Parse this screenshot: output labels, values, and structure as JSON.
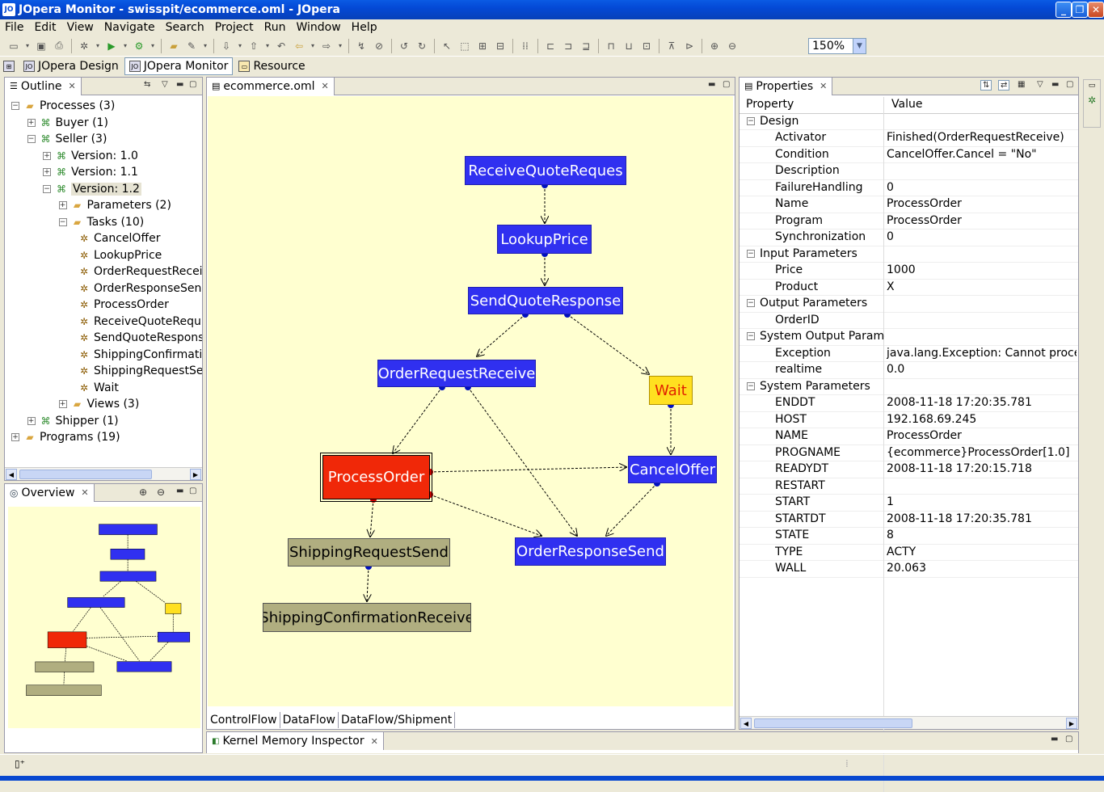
{
  "window": {
    "title": "JOpera Monitor - swisspit/ecommerce.oml - JOpera",
    "icon_text": "JO"
  },
  "menu": [
    "File",
    "Edit",
    "View",
    "Navigate",
    "Search",
    "Project",
    "Run",
    "Window",
    "Help"
  ],
  "toolbar": {
    "zoom": "150%"
  },
  "perspectives": [
    "JOpera Design",
    "JOpera Monitor",
    "Resource"
  ],
  "outline": {
    "tab": "Outline",
    "rows": [
      {
        "label": "Processes (3)",
        "depth": 0,
        "toggle": "−",
        "icon": "folder"
      },
      {
        "label": "Buyer (1)",
        "depth": 1,
        "toggle": "+",
        "icon": "proc"
      },
      {
        "label": "Seller (3)",
        "depth": 1,
        "toggle": "−",
        "icon": "proc"
      },
      {
        "label": "Version: 1.0",
        "depth": 2,
        "toggle": "+",
        "icon": "proc"
      },
      {
        "label": "Version: 1.1",
        "depth": 2,
        "toggle": "+",
        "icon": "proc"
      },
      {
        "label": "Version: 1.2",
        "depth": 2,
        "toggle": "−",
        "icon": "proc",
        "selected": true
      },
      {
        "label": "Parameters (2)",
        "depth": 3,
        "toggle": "+",
        "icon": "folder"
      },
      {
        "label": "Tasks (10)",
        "depth": 3,
        "toggle": "−",
        "icon": "folder"
      },
      {
        "label": "CancelOffer",
        "depth": 4,
        "icon": "task"
      },
      {
        "label": "LookupPrice",
        "depth": 4,
        "icon": "task"
      },
      {
        "label": "OrderRequestRecei",
        "depth": 4,
        "icon": "task"
      },
      {
        "label": "OrderResponseSen",
        "depth": 4,
        "icon": "task"
      },
      {
        "label": "ProcessOrder",
        "depth": 4,
        "icon": "task"
      },
      {
        "label": "ReceiveQuoteRequ",
        "depth": 4,
        "icon": "task"
      },
      {
        "label": "SendQuoteRespons",
        "depth": 4,
        "icon": "task"
      },
      {
        "label": "ShippingConfirmatio",
        "depth": 4,
        "icon": "task"
      },
      {
        "label": "ShippingRequestSer",
        "depth": 4,
        "icon": "task"
      },
      {
        "label": "Wait",
        "depth": 4,
        "icon": "task"
      },
      {
        "label": "Views (3)",
        "depth": 3,
        "toggle": "+",
        "icon": "folder"
      },
      {
        "label": "Shipper (1)",
        "depth": 1,
        "toggle": "+",
        "icon": "proc"
      },
      {
        "label": "Programs (19)",
        "depth": 0,
        "toggle": "+",
        "icon": "folder"
      }
    ]
  },
  "overview": {
    "tab": "Overview"
  },
  "editor": {
    "tab": "ecommerce.oml",
    "bottom_tabs": [
      "ControlFlow",
      "DataFlow",
      "DataFlow/Shipment"
    ],
    "nodes": [
      {
        "id": "rqr",
        "label": "ReceiveQuoteReques",
        "style": "blue"
      },
      {
        "id": "lp",
        "label": "LookupPrice",
        "style": "blue"
      },
      {
        "id": "sqr",
        "label": "SendQuoteResponse",
        "style": "blue"
      },
      {
        "id": "orr",
        "label": "OrderRequestReceive",
        "style": "blue"
      },
      {
        "id": "wait",
        "label": "Wait",
        "style": "yellow"
      },
      {
        "id": "po",
        "label": "ProcessOrder",
        "style": "red"
      },
      {
        "id": "co",
        "label": "CancelOffer",
        "style": "blue"
      },
      {
        "id": "ors",
        "label": "OrderResponseSend",
        "style": "blue"
      },
      {
        "id": "srs",
        "label": "ShippingRequestSend",
        "style": "gray"
      },
      {
        "id": "scr",
        "label": "ShippingConfirmationReceive",
        "style": "gray"
      }
    ],
    "edges": [
      [
        "rqr",
        "lp"
      ],
      [
        "lp",
        "sqr"
      ],
      [
        "sqr",
        "orr"
      ],
      [
        "sqr",
        "wait"
      ],
      [
        "orr",
        "po"
      ],
      [
        "orr",
        "ors"
      ],
      [
        "wait",
        "co"
      ],
      [
        "po",
        "co"
      ],
      [
        "po",
        "ors"
      ],
      [
        "co",
        "ors"
      ],
      [
        "po",
        "srs"
      ],
      [
        "srs",
        "scr"
      ]
    ]
  },
  "properties": {
    "tab": "Properties",
    "header": {
      "property": "Property",
      "value": "Value"
    },
    "rows": [
      {
        "k": "Design",
        "g": true
      },
      {
        "k": "Activator",
        "v": "Finished(OrderRequestReceive)"
      },
      {
        "k": "Condition",
        "v": "CancelOffer.Cancel = \"No\""
      },
      {
        "k": "Description",
        "v": ""
      },
      {
        "k": "FailureHandling",
        "v": "0"
      },
      {
        "k": "Name",
        "v": "ProcessOrder"
      },
      {
        "k": "Program",
        "v": "ProcessOrder"
      },
      {
        "k": "Synchronization",
        "v": "0"
      },
      {
        "k": "Input Parameters",
        "g": true
      },
      {
        "k": "Price",
        "v": "1000"
      },
      {
        "k": "Product",
        "v": "X"
      },
      {
        "k": "Output Parameters",
        "g": true
      },
      {
        "k": "OrderID",
        "v": ""
      },
      {
        "k": "System Output Paramet",
        "g": true
      },
      {
        "k": "Exception",
        "v": "java.lang.Exception: Cannot process"
      },
      {
        "k": "realtime",
        "v": "0.0"
      },
      {
        "k": "System Parameters",
        "g": true
      },
      {
        "k": "ENDDT",
        "v": "2008-11-18 17:20:35.781"
      },
      {
        "k": "HOST",
        "v": "192.168.69.245"
      },
      {
        "k": "NAME",
        "v": "ProcessOrder"
      },
      {
        "k": "PROGNAME",
        "v": "{ecommerce}ProcessOrder[1.0]"
      },
      {
        "k": "READYDT",
        "v": "2008-11-18 17:20:15.718"
      },
      {
        "k": "RESTART",
        "v": ""
      },
      {
        "k": "START",
        "v": "1"
      },
      {
        "k": "STARTDT",
        "v": "2008-11-18 17:20:35.781"
      },
      {
        "k": "STATE",
        "v": "8"
      },
      {
        "k": "TYPE",
        "v": "ACTY"
      },
      {
        "k": "WALL",
        "v": "20.063"
      }
    ]
  },
  "kernel": {
    "tab": "Kernel Memory Inspector"
  }
}
